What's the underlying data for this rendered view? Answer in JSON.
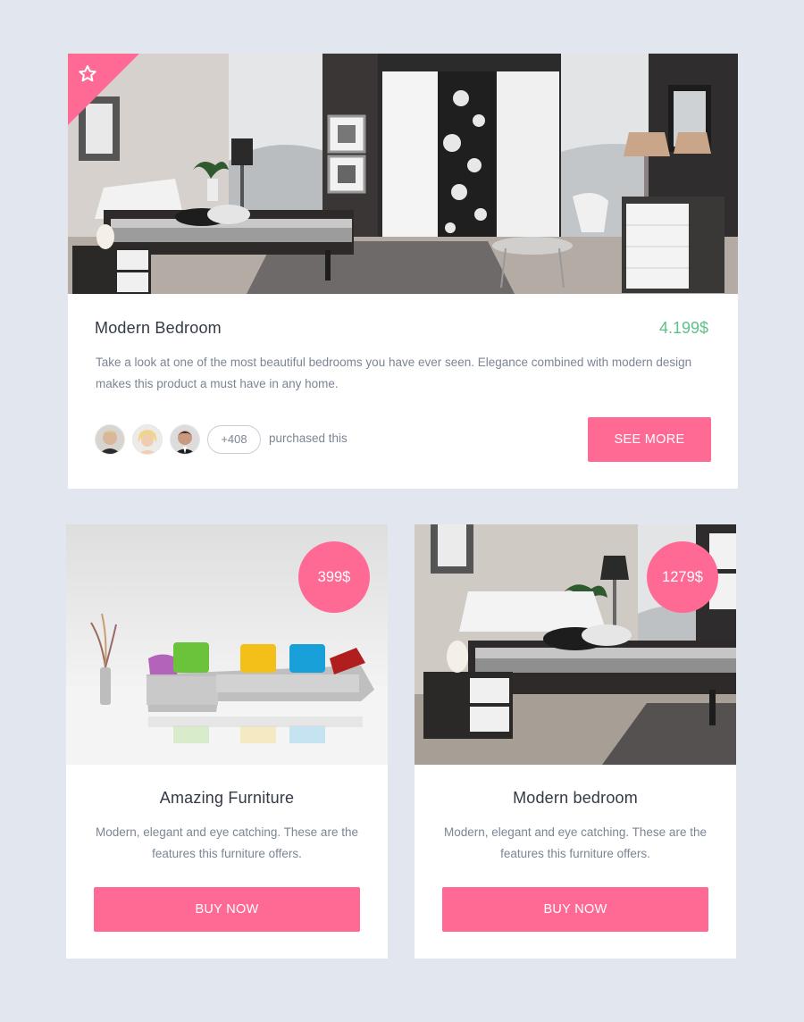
{
  "featured": {
    "title": "Modern Bedroom",
    "price": "4.199$",
    "description": "Take a look at one of the most beautiful bedrooms you have ever seen. Elegance combined with modern design makes this product a must have in any home.",
    "favorite_icon": "star-icon",
    "purchasers": {
      "avatars": [
        "avatar-man-blond",
        "avatar-woman-blonde",
        "avatar-man-dark-hair"
      ],
      "count": "+408",
      "label": "purchased this"
    },
    "button_label": "SEE MORE"
  },
  "products": [
    {
      "title": "Amazing Furniture",
      "price": "399$",
      "description": "Modern, elegant and eye catching. These are the features this furniture offers.",
      "button_label": "BUY NOW"
    },
    {
      "title": "Modern bedroom",
      "price": "1279$",
      "description": "Modern, elegant and eye catching. These are the features this furniture offers.",
      "button_label": "BUY NOW"
    }
  ],
  "colors": {
    "accent": "#ff6a95",
    "price_green": "#5fc18b",
    "background": "#e2e7ef",
    "text_dark": "#333a44",
    "text_muted": "#7b8593"
  }
}
